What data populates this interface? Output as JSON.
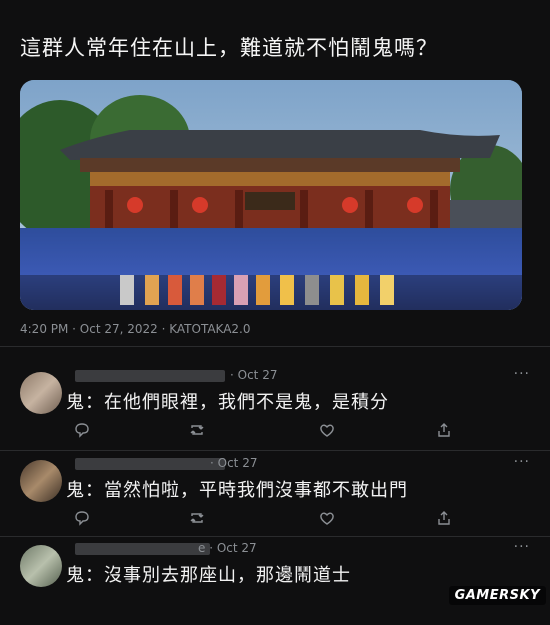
{
  "post": {
    "text": "這群人常年住在山上，難道就不怕鬧鬼嗎？",
    "meta": "4:20 PM · Oct 27, 2022 · KATOTAKA2.0"
  },
  "replies": [
    {
      "date": "· Oct 27",
      "text": "鬼：在他們眼裡，我們不是鬼，是積分",
      "more": "···"
    },
    {
      "date": "· Oct 27",
      "text": "鬼：當然怕啦，平時我們沒事都不敢出門",
      "more": "···"
    },
    {
      "date": "e · Oct 27",
      "text": "鬼：沒事別去那座山，那邊鬧道士",
      "more": "···"
    }
  ],
  "icons": {
    "reply": "reply-bubble-icon",
    "retweet": "retweet-icon",
    "like": "heart-icon",
    "share": "share-icon"
  },
  "watermark": "GAMERSKY"
}
